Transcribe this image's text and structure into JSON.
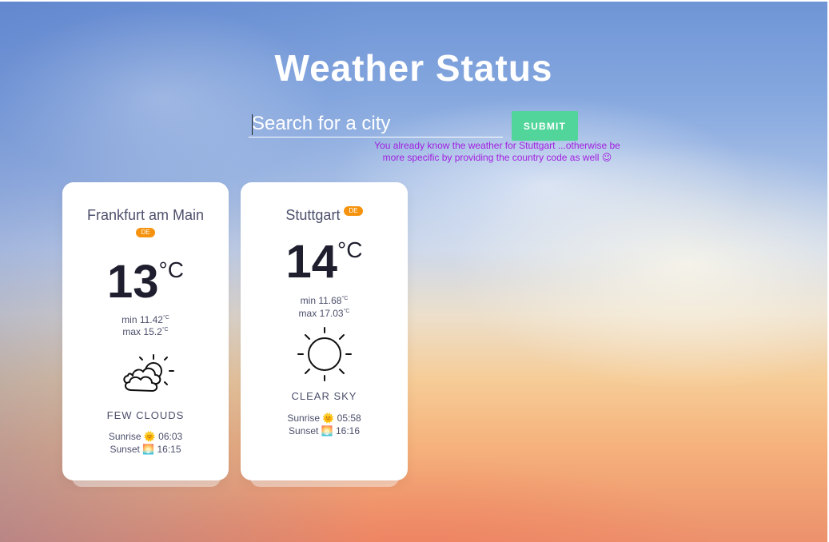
{
  "header": {
    "title": "Weather Status"
  },
  "search": {
    "placeholder": "Search for a city",
    "value": "",
    "submit_label": "SUBMIT",
    "message": "You already know the weather for Stuttgart ...otherwise be more specific by providing the country code as well 😉"
  },
  "cards": [
    {
      "city": "Frankfurt am Main",
      "country": "DE",
      "temp": "13",
      "unit": "°C",
      "min_label": "min",
      "min": "11.42",
      "max_label": "max",
      "max": "15.2",
      "deg": "°C",
      "icon": "few-clouds-icon",
      "description": "FEW CLOUDS",
      "sunrise_label": "Sunrise",
      "sunrise_emoji": "🌞",
      "sunrise": "06:03",
      "sunset_label": "Sunset",
      "sunset_emoji": "🌅",
      "sunset": "16:15"
    },
    {
      "city": "Stuttgart",
      "country": "DE",
      "temp": "14",
      "unit": "°C",
      "min_label": "min",
      "min": "11.68",
      "max_label": "max",
      "max": "17.03",
      "deg": "°C",
      "icon": "clear-sky-icon",
      "description": "CLEAR SKY",
      "sunrise_label": "Sunrise",
      "sunrise_emoji": "🌞",
      "sunrise": "05:58",
      "sunset_label": "Sunset",
      "sunset_emoji": "🌅",
      "sunset": "16:16"
    }
  ],
  "colors": {
    "submit": "#52d59a",
    "badge": "#f5930e",
    "message": "#a21ee0",
    "title": "#ffffff"
  }
}
